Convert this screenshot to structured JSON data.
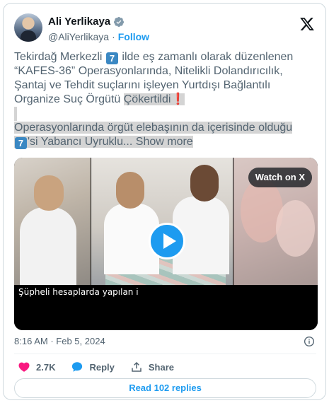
{
  "author": {
    "name": "Ali Yerlikaya",
    "handle": "@AliYerlikaya",
    "separator": "·",
    "follow_label": "Follow"
  },
  "tweet": {
    "line1_pre": "Tekirdağ Merkezli ",
    "line1_emoji": "7",
    "line1_post": " ilde eş zamanlı olarak düzenlenen",
    "line2": "“KAFES-36” Operasyonlarında, Nitelikli Dolandırıcılık,",
    "line3": "Şantaj ve Tehdit suçlarını işleyen Yurtdışı Bağlantılı",
    "line4_pre": "Organize Suç Örgütü ",
    "line4_hl": "Çökertildi",
    "line4_emoji": "❗",
    "line6": "Operasyonlarında örgüt elebaşının da içerisinde olduğu",
    "line7_emoji": "7",
    "line7_text": "'si Yabancı Uyruklu...",
    "show_more": "Show more"
  },
  "media": {
    "caption": "Şüpheli hesaplarda yapılan i",
    "watch_label": "Watch on X"
  },
  "meta": {
    "time": "8:16 AM",
    "separator": "·",
    "date": "Feb 5, 2024"
  },
  "actions": {
    "likes": "2.7K",
    "reply_label": "Reply",
    "share_label": "Share"
  },
  "read_replies_label": "Read 102 replies",
  "colors": {
    "accent": "#1d9bf0",
    "text_secondary": "#536471",
    "like_red": "#f91880",
    "highlight": "#d4d4d4"
  }
}
